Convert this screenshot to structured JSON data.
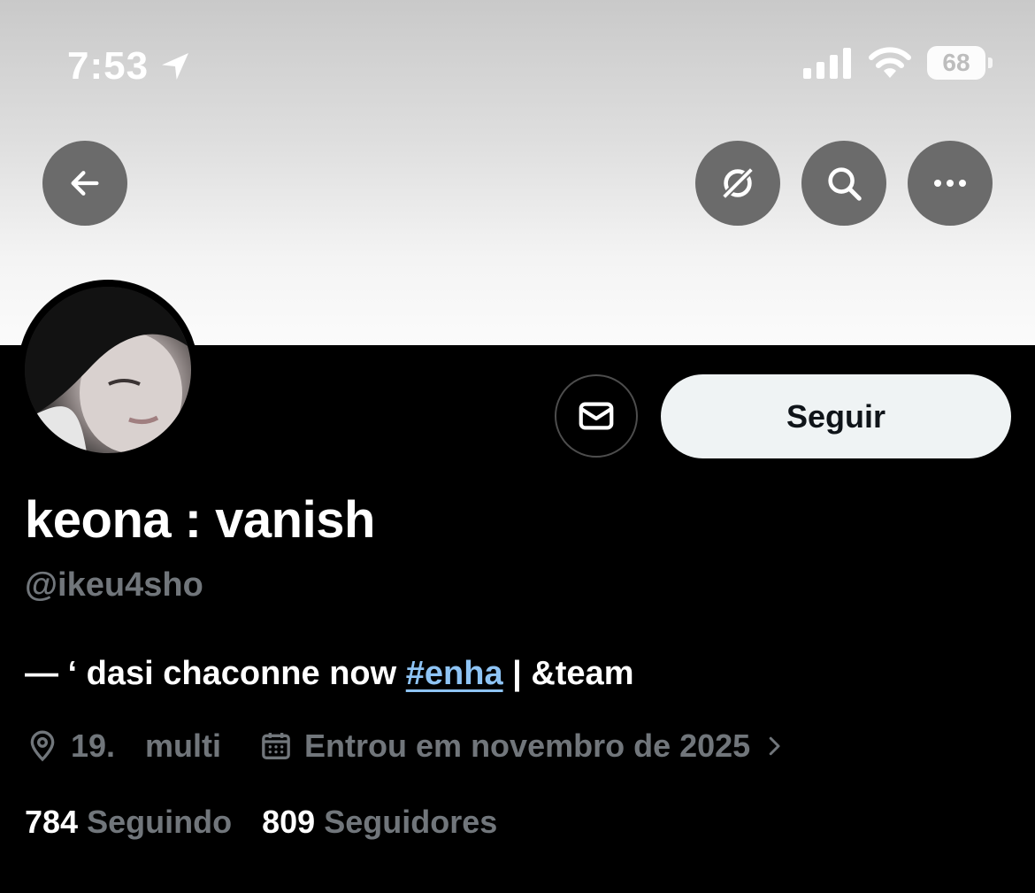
{
  "status_bar": {
    "time": "7:53",
    "battery": "68"
  },
  "profile": {
    "display_name": "keona : vanish",
    "handle": "@ikeu4sho",
    "bio_prefix": "— ‘ dasi chaconne now ",
    "bio_hashtag": "#enha",
    "bio_suffix": " | &team",
    "location": "19.",
    "extra": "multi",
    "joined": "Entrou em novembro de 2025",
    "following_count": "784",
    "following_label": "Seguindo",
    "followers_count": "809",
    "followers_label": "Seguidores"
  },
  "actions": {
    "follow_label": "Seguir"
  },
  "icons": {
    "back": "arrow-left-icon",
    "grok": "grok-icon",
    "search": "search-icon",
    "more": "more-dots-icon",
    "mail": "mail-icon",
    "location": "location-pin-icon",
    "calendar": "calendar-icon",
    "chevron": "chevron-right-icon"
  },
  "colors": {
    "accent_link": "#8ec4f5",
    "muted_text": "#71767b",
    "button_bg": "#eff3f4"
  }
}
